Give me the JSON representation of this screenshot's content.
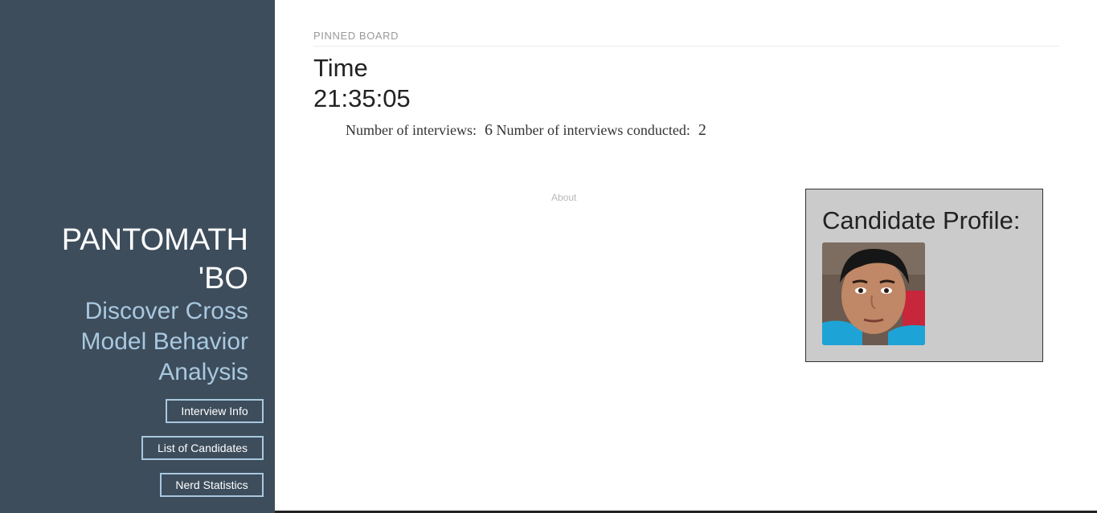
{
  "sidebar": {
    "brand_line1": "PANTOMATH",
    "brand_line2": "'BO",
    "tagline_line1": "Discover Cross",
    "tagline_line2": "Model Behavior",
    "tagline_line3": "Analysis",
    "nav": [
      {
        "label": "Interview Info"
      },
      {
        "label": "List of Candidates"
      },
      {
        "label": "Nerd Statistics"
      }
    ]
  },
  "main": {
    "section_label": "PINNED BOARD",
    "time_label": "Time",
    "time_value": "21:35:05",
    "stats": {
      "interviews_label": "Number of interviews:",
      "interviews_value": "6",
      "conducted_label": "Number of interviews conducted:",
      "conducted_value": "2"
    },
    "about_link": "About",
    "profile": {
      "title": "Candidate Profile:"
    }
  },
  "colors": {
    "sidebar_bg": "#3d4d5c",
    "accent_light_blue": "#a9c8df",
    "profile_card_bg": "#cbcbcb"
  }
}
